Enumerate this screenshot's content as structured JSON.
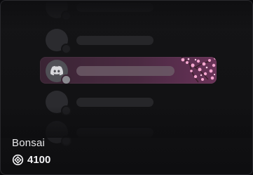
{
  "item": {
    "name": "Bonsai",
    "price": "4100",
    "price_icon": "orb-currency-icon"
  },
  "preview": {
    "rows": [
      {
        "state": "placeholder"
      },
      {
        "state": "placeholder"
      },
      {
        "state": "selected",
        "avatar_icon": "discord-icon",
        "decoration": "cherry-blossom"
      },
      {
        "state": "placeholder"
      },
      {
        "state": "placeholder"
      }
    ]
  },
  "colors": {
    "selected_row": "#4a2a41",
    "blossom": "#f4a6cf",
    "text": "#e8e8ea"
  }
}
